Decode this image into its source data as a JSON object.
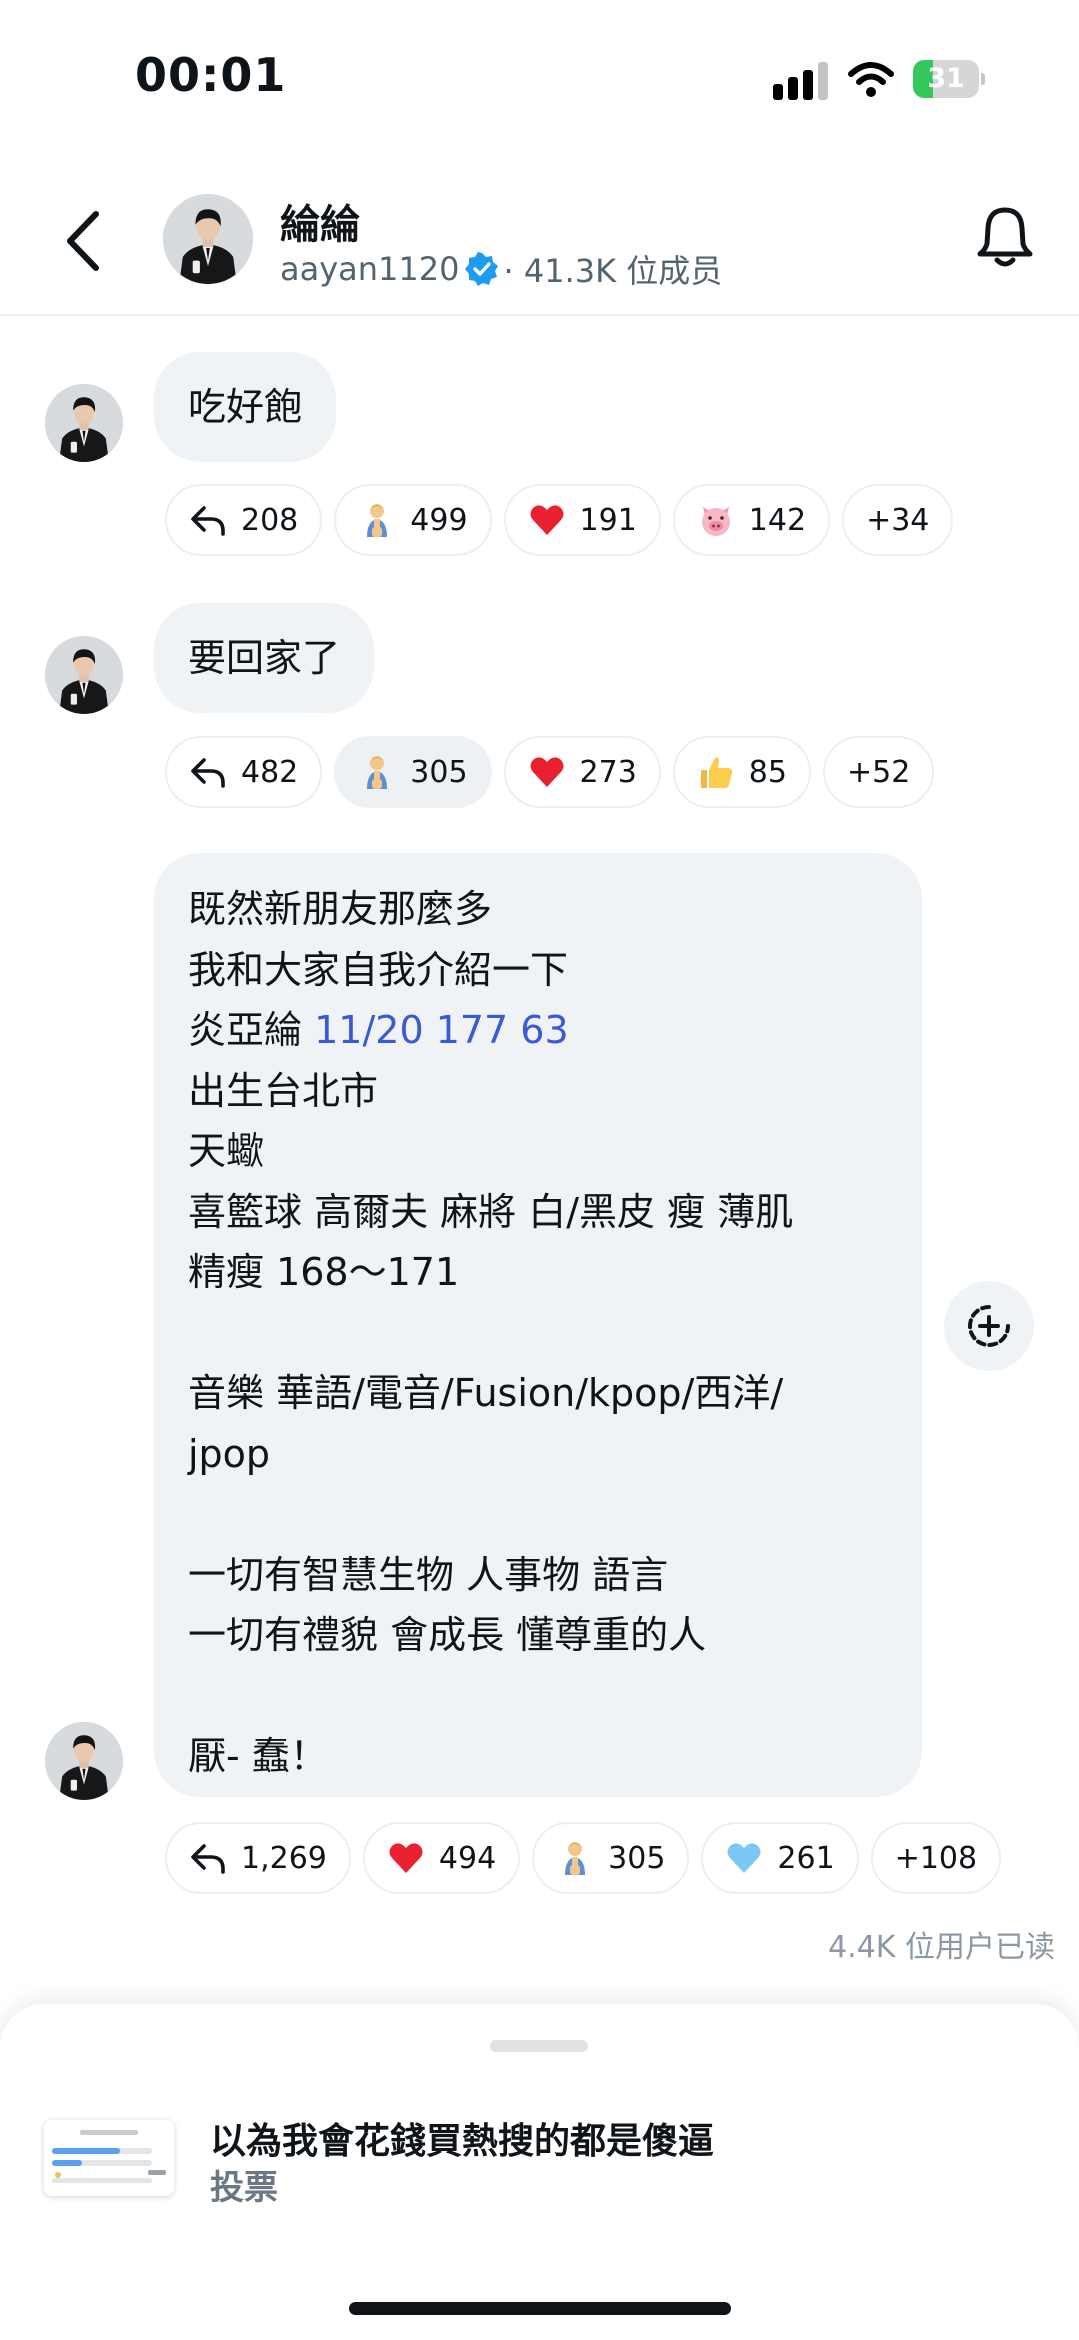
{
  "status_bar": {
    "time": "00:01",
    "battery": "31",
    "battery_level": 0.31
  },
  "header": {
    "channel_name": "綸綸",
    "username": "aayan1120",
    "members": "· 41.3K 位成员"
  },
  "messages": [
    {
      "text": "吃好飽",
      "reactions": [
        {
          "icon": "reply-icon",
          "count": "208"
        },
        {
          "icon": "person-emoji-icon",
          "count": "499"
        },
        {
          "icon": "heart-emoji-icon",
          "count": "191"
        },
        {
          "icon": "pig-emoji-icon",
          "count": "142"
        },
        {
          "count": "+34"
        }
      ]
    },
    {
      "text": "要回家了",
      "reactions": [
        {
          "icon": "reply-icon",
          "count": "482"
        },
        {
          "icon": "person-emoji-icon",
          "count": "305",
          "selected": true
        },
        {
          "icon": "heart-emoji-icon",
          "count": "273"
        },
        {
          "icon": "thumbs-up-emoji-icon",
          "count": "85"
        },
        {
          "count": "+52"
        }
      ]
    },
    {
      "lines": [
        "既然新朋友那麼多",
        "我和大家自我介紹一下",
        "炎亞綸",
        "11/20 177 63",
        "出生台北市",
        "天蠍",
        "喜籃球 高爾夫 麻將 白/黑皮 瘦 薄肌",
        "精瘦 168～171",
        "音樂 華語/電音/Fusion/kpop/西洋/",
        "jpop",
        "一切有智慧生物 人事物 語言",
        "一切有禮貌 會成長 懂尊重的人",
        "厭- 蠢！"
      ],
      "reactions": [
        {
          "icon": "reply-icon",
          "count": "1,269"
        },
        {
          "icon": "heart-emoji-icon",
          "count": "494"
        },
        {
          "icon": "person-emoji-icon",
          "count": "305"
        },
        {
          "icon": "blue-heart-emoji-icon",
          "count": "261"
        },
        {
          "count": "+108"
        }
      ]
    }
  ],
  "read_count": "4.4K 位用户已读",
  "poll": {
    "title": "以為我會花錢買熱搜的都是傻逼",
    "subtitle": "投票"
  },
  "colors": {
    "bubble": "#f0f3f5",
    "link": "#3b58d6",
    "verified": "#1d9bf0",
    "battery": "#34c759"
  }
}
